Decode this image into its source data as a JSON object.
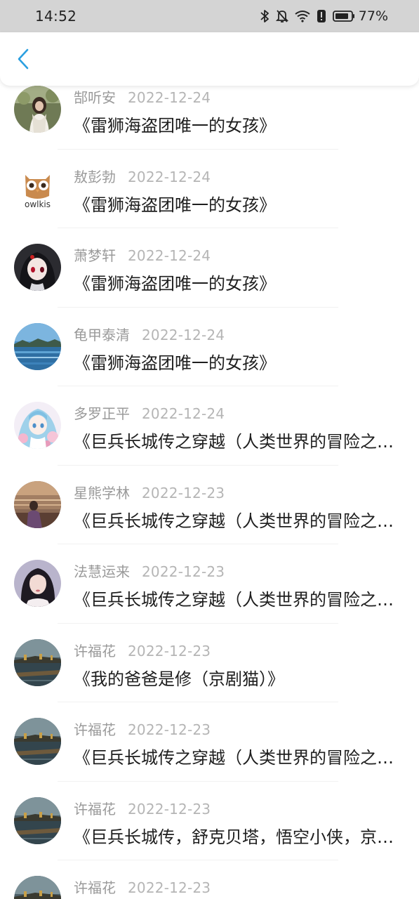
{
  "status_bar": {
    "time": "14:52",
    "battery_percent": "77%",
    "icons": [
      "bluetooth-icon",
      "mute-bell-icon",
      "wifi-icon",
      "alert-icon",
      "battery-icon"
    ]
  },
  "header": {
    "back_icon": "chevron-left-icon",
    "accent_color": "#2a9fe0"
  },
  "items": [
    {
      "user": "郜听安",
      "date": "2022-12-24",
      "title": "《雷狮海盗团唯一的女孩》",
      "avatar": "photo-girl-garden"
    },
    {
      "user": "敖彭勃",
      "date": "2022-12-24",
      "title": "《雷狮海盗团唯一的女孩》",
      "avatar": "owl-logo",
      "avatar_text": "owlkis"
    },
    {
      "user": "萧梦轩",
      "date": "2022-12-24",
      "title": "《雷狮海盗团唯一的女孩》",
      "avatar": "anime-dark-girl"
    },
    {
      "user": "龟甲泰清",
      "date": "2022-12-24",
      "title": "《雷狮海盗团唯一的女孩》",
      "avatar": "lake-landscape"
    },
    {
      "user": "多罗正平",
      "date": "2022-12-24",
      "title": "《巨兵长城传之穿越（人类世界的冒险之旅）》",
      "avatar": "anime-pastel-girl"
    },
    {
      "user": "星熊学林",
      "date": "2022-12-23",
      "title": "《巨兵长城传之穿越（人类世界的冒险之旅）》",
      "avatar": "sunset-sea-girl"
    },
    {
      "user": "法慧运来",
      "date": "2022-12-23",
      "title": "《巨兵长城传之穿越（人类世界的冒险之旅）》",
      "avatar": "portrait-girl"
    },
    {
      "user": "许福花",
      "date": "2022-12-23",
      "title": "《我的爸爸是修（京剧猫）》",
      "avatar": "pier-dusk"
    },
    {
      "user": "许福花",
      "date": "2022-12-23",
      "title": "《巨兵长城传之穿越（人类世界的冒险之旅）》",
      "avatar": "pier-dusk"
    },
    {
      "user": "许福花",
      "date": "2022-12-23",
      "title": "《巨兵长城传，舒克贝塔，悟空小侠，京剧猫》",
      "avatar": "pier-dusk"
    },
    {
      "user": "许福花",
      "date": "2022-12-23",
      "title": "",
      "avatar": "pier-dusk"
    }
  ]
}
